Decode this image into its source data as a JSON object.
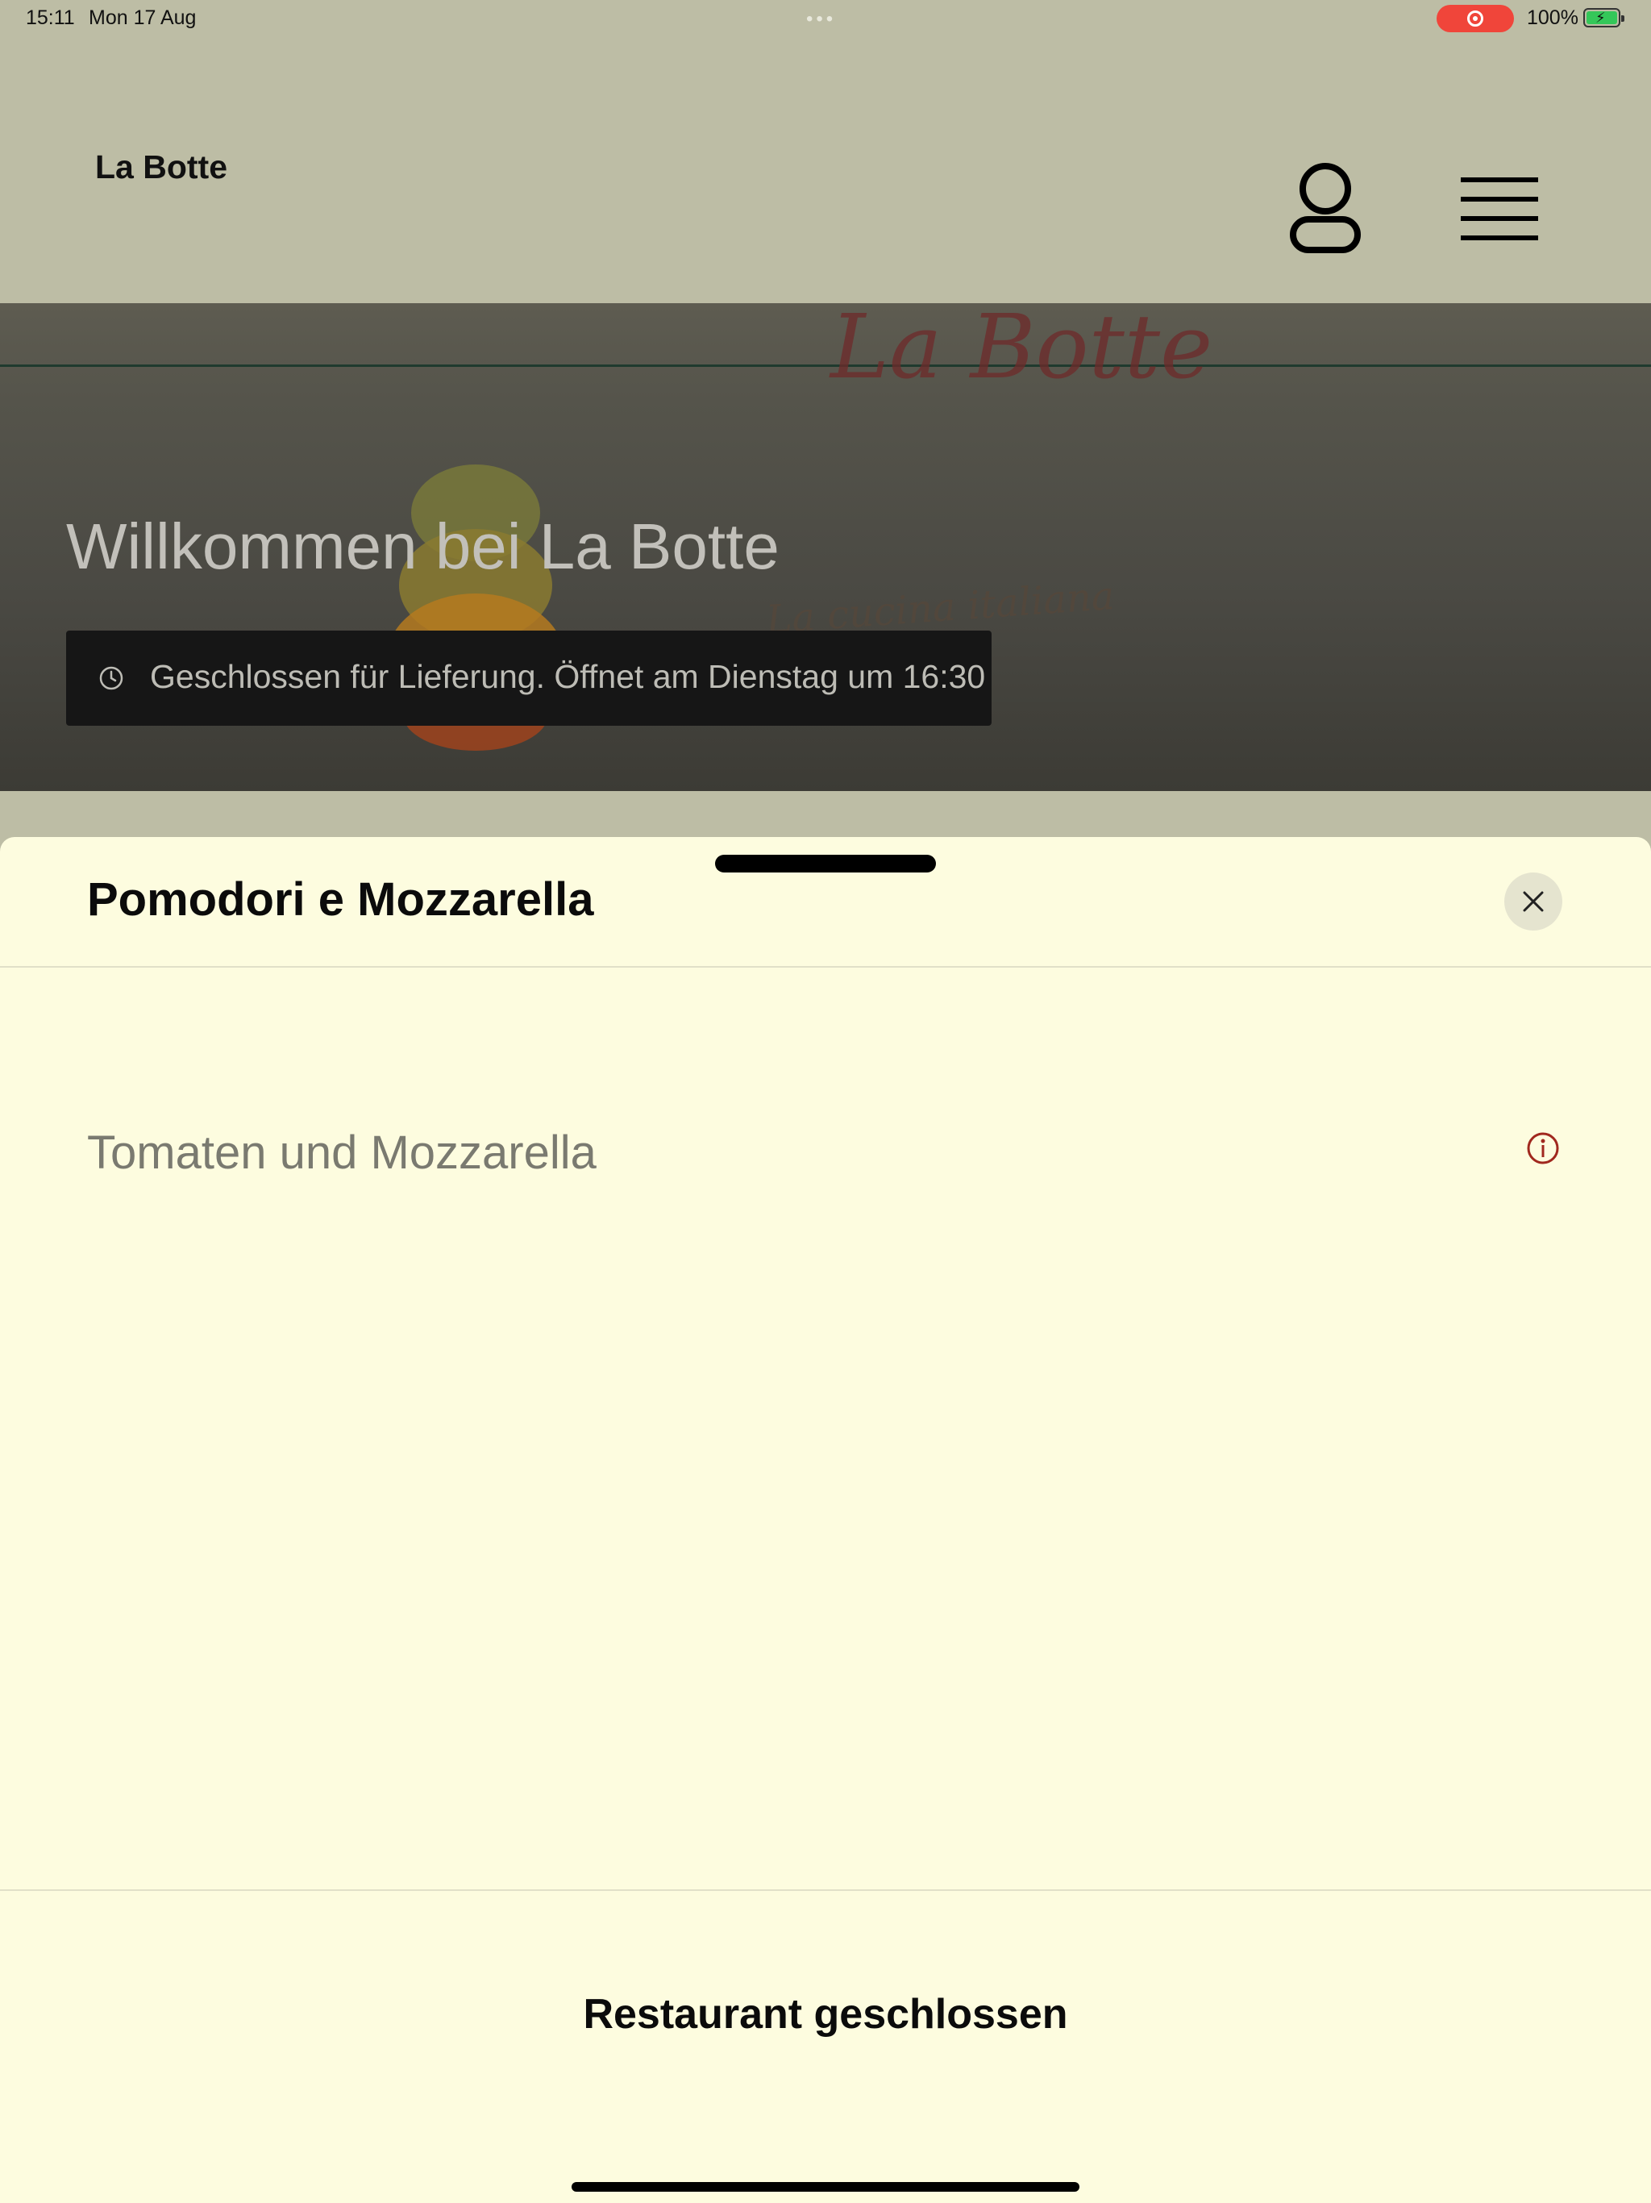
{
  "status_bar": {
    "time": "15:11",
    "date": "Mon 17 Aug",
    "battery_percent": "100%",
    "icons": [
      "screen-recording-icon",
      "battery-charging-icon"
    ]
  },
  "header": {
    "brand": "La Botte",
    "icons": [
      "user-icon",
      "menu-icon"
    ]
  },
  "hero": {
    "title": "Willkommen bei La Botte",
    "notice": "Geschlossen für Lieferung. Öffnet am Dienstag um 16:30",
    "notice_icon": "clock-icon",
    "logo_script": "La Botte",
    "logo_tagline": "La cucina italiana"
  },
  "sheet": {
    "title": "Pomodori e Mozzarella",
    "description": "Tomaten und Mozzarella",
    "footer_status": "Restaurant geschlossen",
    "icons": [
      "close-icon",
      "info-icon"
    ],
    "accent_color": "#a0281e"
  }
}
